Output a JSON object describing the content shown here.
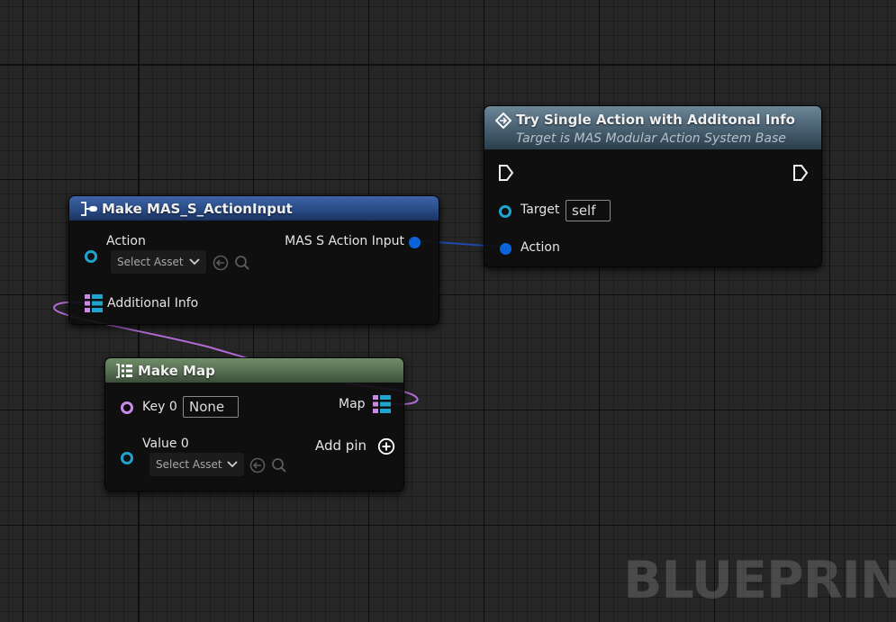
{
  "canvas": {
    "watermark": "BLUEPRINT"
  },
  "colors": {
    "background": "#262626",
    "struct_pin": "#0a64d8",
    "object_pin": "#1fa3cf",
    "name_pin": "#c98ae8",
    "map_wire": "#b36bd8",
    "struct_wire": "#1e4bb0",
    "header_blue": "#2a4c86",
    "header_green": "#5f7a5a",
    "header_function": "#5e7585"
  },
  "node_make_action_input": {
    "title": "Make MAS_S_ActionInput",
    "title_icon": "make-struct-icon",
    "pins": {
      "action_label": "Action",
      "action_select": "Select Asset",
      "output_label": "MAS S Action Input",
      "additional_info_label": "Additional Info"
    }
  },
  "node_try_single_action": {
    "title": "Try Single Action with Additonal Info",
    "subtitle": "Target is MAS Modular Action System Base",
    "title_icon": "function-icon",
    "pins": {
      "target_label": "Target",
      "target_value": "self",
      "action_label": "Action"
    }
  },
  "node_make_map": {
    "title": "Make Map",
    "title_icon": "make-map-icon",
    "pins": {
      "key_label": "Key 0",
      "key_value": "None",
      "map_label": "Map",
      "value_label": "Value 0",
      "value_select": "Select Asset",
      "add_pin_label": "Add pin"
    }
  }
}
